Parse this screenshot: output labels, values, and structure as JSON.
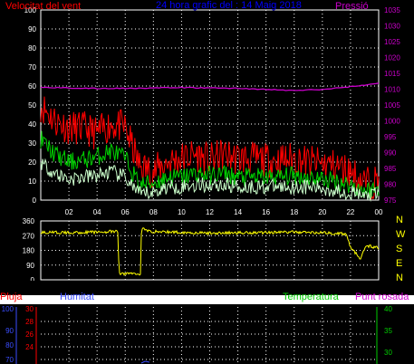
{
  "chart_data": [
    {
      "type": "line",
      "title": "24 hora grafic del : 14 Maig 2018",
      "left_axis_label": "Velocitat del vent",
      "right_axis_label": "Pressió",
      "left_ylim": [
        0,
        100
      ],
      "left_ticks": [
        "0",
        "10",
        "20",
        "30",
        "40",
        "50",
        "60",
        "70",
        "80",
        "90",
        "100"
      ],
      "right_ylim": [
        975,
        1035
      ],
      "right_ticks": [
        "975",
        "980",
        "985",
        "990",
        "995",
        "1000",
        "1005",
        "1010",
        "1015",
        "1020",
        "1025",
        "1030",
        "1035"
      ],
      "x_ticks": [
        "02",
        "04",
        "06",
        "08",
        "10",
        "12",
        "14",
        "16",
        "18",
        "20",
        "22",
        "00"
      ],
      "grid": true,
      "series": [
        {
          "color": "#ff0000",
          "x": [
            0,
            1,
            2,
            3,
            4,
            5,
            6,
            7,
            8,
            9,
            10,
            11,
            12,
            13,
            14,
            15,
            16,
            17,
            18,
            19,
            20,
            21,
            22,
            23,
            24
          ],
          "values": [
            50,
            42,
            38,
            38,
            35,
            40,
            38,
            18,
            15,
            20,
            22,
            24,
            21,
            24,
            22,
            22,
            21,
            21,
            22,
            20,
            19,
            18,
            15,
            9,
            10
          ]
        },
        {
          "color": "#00d000",
          "x": [
            0,
            1,
            2,
            3,
            4,
            5,
            6,
            7,
            8,
            9,
            10,
            11,
            12,
            13,
            14,
            15,
            16,
            17,
            18,
            19,
            20,
            21,
            22,
            23,
            24
          ],
          "values": [
            32,
            24,
            20,
            21,
            23,
            26,
            22,
            8,
            9,
            12,
            12,
            14,
            13,
            14,
            12,
            12,
            12,
            12,
            13,
            12,
            11,
            10,
            8,
            5,
            6
          ]
        },
        {
          "color": "#ccffcc",
          "x": [
            0,
            1,
            2,
            3,
            4,
            5,
            6,
            7,
            8,
            9,
            10,
            11,
            12,
            13,
            14,
            15,
            16,
            17,
            18,
            19,
            20,
            21,
            22,
            23,
            24
          ],
          "values": [
            20,
            14,
            11,
            12,
            13,
            15,
            12,
            3,
            4,
            7,
            7,
            8,
            8,
            8,
            7,
            7,
            7,
            7,
            7,
            7,
            6,
            5,
            4,
            2,
            3
          ]
        },
        {
          "color": "#cc00cc",
          "x": [
            0,
            2,
            4,
            6,
            8,
            10,
            12,
            14,
            16,
            18,
            20,
            22,
            24
          ],
          "values": [
            1010.6,
            1010.4,
            1010.2,
            1010.3,
            1010.4,
            1010.5,
            1010.4,
            1010.3,
            1009.9,
            1009.6,
            1009.9,
            1010.8,
            1011.8
          ]
        }
      ]
    },
    {
      "type": "line",
      "ylim": [
        0,
        360
      ],
      "left_ticks": [
        "0",
        "90",
        "180",
        "270",
        "360"
      ],
      "compass_labels": [
        "N",
        "W",
        "S",
        "E",
        "N"
      ],
      "x_ticks": [
        "02",
        "04",
        "06",
        "08",
        "10",
        "12",
        "14",
        "16",
        "18",
        "20",
        "22",
        "00"
      ],
      "grid": true,
      "series": [
        {
          "color": "#ffff00",
          "x": [
            0,
            2,
            4,
            5.5,
            5.55,
            5.7,
            6.2,
            6.7,
            7.1,
            7.15,
            7.5,
            8,
            10,
            12,
            14,
            16,
            18,
            20,
            21.7,
            22,
            22.4,
            22.7,
            23.1,
            24
          ],
          "values": [
            290,
            288,
            292,
            295,
            40,
            35,
            40,
            38,
            35,
            320,
            300,
            295,
            290,
            285,
            288,
            290,
            292,
            288,
            280,
            200,
            160,
            120,
            210,
            195
          ]
        }
      ]
    },
    {
      "type": "line",
      "axis_labels": [
        "Pluja",
        "Humitat",
        "Temperatura",
        "Punt rosada"
      ],
      "left_ticks_humitat": [
        "70",
        "80",
        "90",
        "100"
      ],
      "left_ticks_pluja": [
        "30",
        "28",
        "26",
        "24"
      ],
      "right_ticks": [
        "30",
        "35",
        "40"
      ],
      "grid": true,
      "series": []
    }
  ],
  "colors": {
    "wind_gust": "#ff0000",
    "wind_avg": "#00d000",
    "wind_min": "#ccffcc",
    "pressure": "#cc00cc",
    "direction": "#ffff00",
    "title_text": "#0000ff",
    "humitat_text": "#3a4dff",
    "temperatura_text": "#00cc00"
  }
}
